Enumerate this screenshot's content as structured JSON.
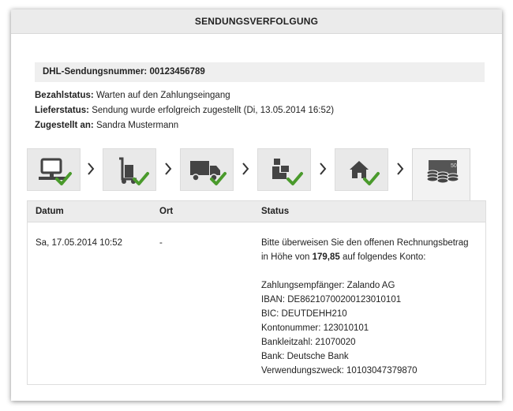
{
  "header": {
    "title": "SENDUNGSVERFOLGUNG"
  },
  "tracking": {
    "label": "DHL-Sendungsnummer:",
    "number": "00123456789"
  },
  "info": {
    "payment_label": "Bezahlstatus:",
    "payment_value": "Warten auf den Zahlungseingang",
    "delivery_label": "Lieferstatus:",
    "delivery_value": "Sendung wurde erfolgreich zugestellt (Di, 13.05.2014 16:52)",
    "recipient_label": "Zugestellt an:",
    "recipient_value": "Sandra Mustermann"
  },
  "steps": [
    {
      "icon": "computer-icon",
      "done": true
    },
    {
      "icon": "handcart-icon",
      "done": true
    },
    {
      "icon": "truck-icon",
      "done": true
    },
    {
      "icon": "parcel-handover-icon",
      "done": true
    },
    {
      "icon": "house-icon",
      "done": true
    },
    {
      "icon": "money-icon",
      "done": false,
      "banknote_label": "50"
    }
  ],
  "table": {
    "headers": {
      "date": "Datum",
      "place": "Ort",
      "status": "Status"
    },
    "rows": [
      {
        "date": "Sa, 17.05.2014 10:52",
        "place": "-",
        "status_line1": "Bitte überweisen Sie den offenen Rechnungsbetrag",
        "status_line2_pre": "in Höhe von ",
        "status_amount": "179,85",
        "status_line2_post": " auf folgendes Konto:",
        "bank_details": [
          "Zahlungsempfänger: Zalando AG",
          "IBAN: DE86210700200123010101",
          "BIC: DEUTDEHH210",
          "Kontonummer: 123010101",
          "Bankleitzahl: 21070020",
          "Bank: Deutsche Bank",
          "Verwendungszweck: 10103047379870"
        ]
      }
    ]
  },
  "colors": {
    "check": "#4a9a2c",
    "icon": "#444444",
    "header_bg": "#ebebeb"
  }
}
